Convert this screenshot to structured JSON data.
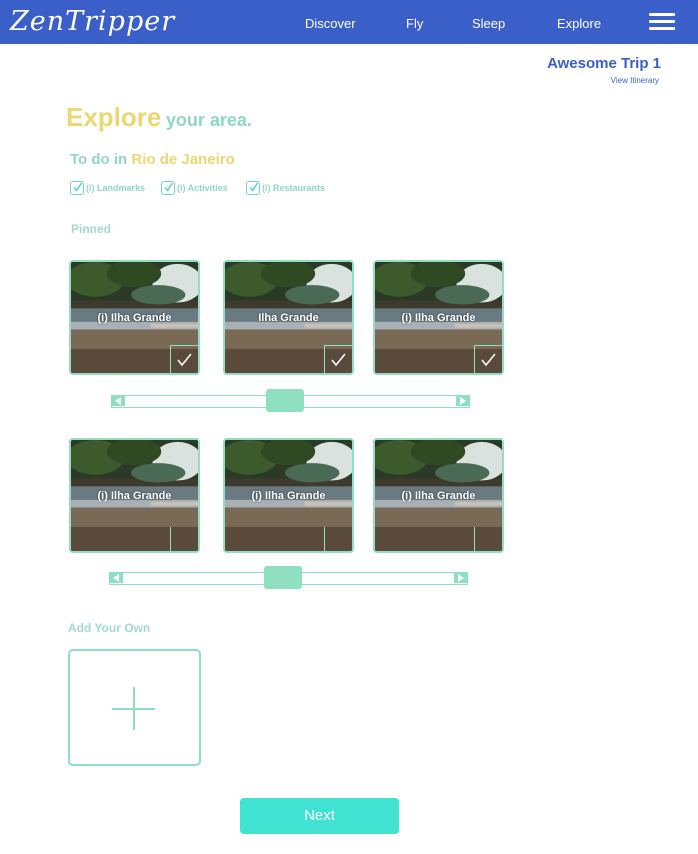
{
  "app": {
    "logo": "ZenTripper"
  },
  "nav": {
    "links": [
      "Discover",
      "Fly",
      "Sleep",
      "Explore"
    ],
    "menu_icon": "hamburger-menu-icon"
  },
  "trip": {
    "title": "Awesome Trip 1",
    "itinerary_link": "View Itinerary"
  },
  "heading": {
    "emphasis": "Explore",
    "rest": "your area."
  },
  "todo": {
    "prefix": "To do in",
    "city": "Rio de Janeiro"
  },
  "filters": [
    {
      "label": "(i) Landmarks",
      "checked": true
    },
    {
      "label": "(i) Activities",
      "checked": true
    },
    {
      "label": "(i) Restaurants",
      "checked": true
    }
  ],
  "pinned_label": "Pinned",
  "pinned_cards": [
    {
      "title": "(i) Ilha Grande",
      "checked": true
    },
    {
      "title": "Ilha Grande",
      "checked": true
    },
    {
      "title": "(i) Ilha Grande",
      "checked": true
    }
  ],
  "suggested_cards": [
    {
      "title": "(i) Ilha Grande",
      "checked": false
    },
    {
      "title": "(i) Ilha Grande",
      "checked": false
    },
    {
      "title": "(i) Ilha Grande",
      "checked": false
    }
  ],
  "add_own_label": "Add Your Own",
  "next_label": "Next",
  "colors": {
    "nav_bg": "#3a5fc8",
    "accent_yellow": "#ebd873",
    "accent_mint": "#8fe0c0",
    "next_button": "#40e2d2"
  }
}
